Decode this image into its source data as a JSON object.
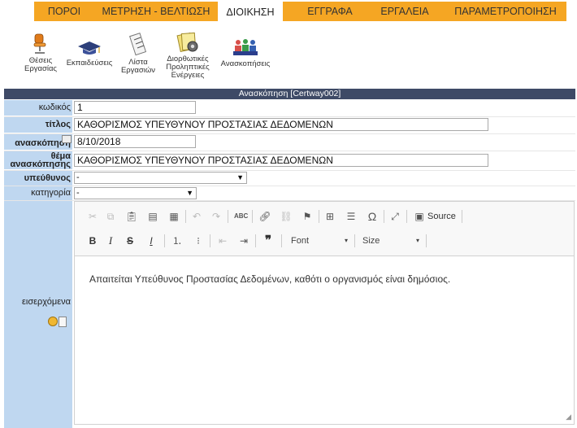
{
  "nav": {
    "items": [
      {
        "label": "ΠΟΡΟΙ"
      },
      {
        "label": "ΜΕΤΡΗΣΗ - ΒΕΛΤΙΩΣΗ"
      },
      {
        "label": "ΔΙΟΙΚΗΣΗ"
      },
      {
        "label": "ΕΓΓΡΑΦΑ"
      },
      {
        "label": "ΕΡΓΑΛΕΙΑ"
      },
      {
        "label": "ΠΑΡΑΜΕΤΡΟΠΟΙΗΣΗ"
      }
    ],
    "active": "ΔΙΟΙΚΗΣΗ",
    "accent": "#f5a623"
  },
  "toolbar": {
    "items": [
      {
        "line1": "Θέσεις",
        "line2": "Εργασίας",
        "line3": "",
        "icon": "chair-icon"
      },
      {
        "line1": "Εκπαιδεύσεις",
        "line2": "",
        "line3": "",
        "icon": "graduation-cap-icon"
      },
      {
        "line1": "Λίστα",
        "line2": "Εργασιών",
        "line3": "",
        "icon": "checklist-icon"
      },
      {
        "line1": "Διορθωτικές",
        "line2": "Προληπτικές",
        "line3": "Ενέργειες",
        "icon": "gear-documents-icon"
      },
      {
        "line1": "Ανασκοπήσεις",
        "line2": "",
        "line3": "",
        "icon": "meeting-people-icon"
      }
    ]
  },
  "header": {
    "title": "Ανασκόπηση [Certway002]",
    "color": "#3e4a66"
  },
  "form": {
    "code": {
      "label": "κωδικός",
      "value": "1"
    },
    "title": {
      "label": "τίτλος",
      "value": "ΚΑΘΟΡΙΣΜΟΣ ΥΠΕΥΘΥΝΟΥ ΠΡΟΣΤΑΣΙΑΣ ΔΕΔΟΜΕΝΩΝ"
    },
    "review": {
      "label": "ανασκόπηση",
      "value": "8/10/2018"
    },
    "subject": {
      "label1": "θέμα",
      "label2": "ανασκόπησης",
      "value": "ΚΑΘΟΡΙΣΜΟΣ ΥΠΕΥΘΥΝΟΥ ΠΡΟΣΤΑΣΙΑΣ ΔΕΔΟΜΕΝΩΝ"
    },
    "responsible": {
      "label": "υπεύθυνος",
      "value": "-"
    },
    "category": {
      "label": "κατηγορία",
      "value": "-"
    },
    "inputs": {
      "label": "εισερχόμενα"
    },
    "label_bg": "#bfd7f0"
  },
  "editor": {
    "source_label": "Source",
    "font_label": "Font",
    "size_label": "Size",
    "content": "Απαιτείται Υπεύθυνος Προστασίας Δεδομένων, καθότι ο οργανισμός είναι δημόσιος."
  }
}
